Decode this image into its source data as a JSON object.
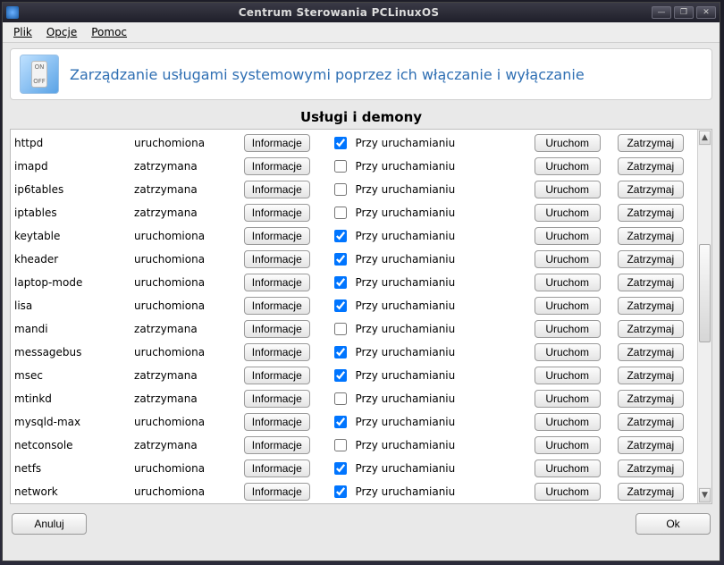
{
  "window": {
    "title": "Centrum Sterowania PCLinuxOS"
  },
  "menu": {
    "plik": "Plik",
    "opcje": "Opcje",
    "pomoc": "Pomoc"
  },
  "banner": {
    "text": "Zarządzanie usługami systemowymi poprzez ich włączanie i wyłączanie"
  },
  "section_title": "Usługi i demony",
  "labels": {
    "info": "Informacje",
    "on_boot": "Przy uruchamianiu",
    "start": "Uruchom",
    "stop": "Zatrzymaj"
  },
  "status": {
    "running": "uruchomiona",
    "stopped": "zatrzymana"
  },
  "footer": {
    "cancel": "Anuluj",
    "ok": "Ok"
  },
  "services": [
    {
      "name": "httpd",
      "status": "running",
      "on_boot": true
    },
    {
      "name": "imapd",
      "status": "stopped",
      "on_boot": false
    },
    {
      "name": "ip6tables",
      "status": "stopped",
      "on_boot": false
    },
    {
      "name": "iptables",
      "status": "stopped",
      "on_boot": false
    },
    {
      "name": "keytable",
      "status": "running",
      "on_boot": true
    },
    {
      "name": "kheader",
      "status": "running",
      "on_boot": true
    },
    {
      "name": "laptop-mode",
      "status": "running",
      "on_boot": true
    },
    {
      "name": "lisa",
      "status": "running",
      "on_boot": true
    },
    {
      "name": "mandi",
      "status": "stopped",
      "on_boot": false
    },
    {
      "name": "messagebus",
      "status": "running",
      "on_boot": true
    },
    {
      "name": "msec",
      "status": "stopped",
      "on_boot": true
    },
    {
      "name": "mtinkd",
      "status": "stopped",
      "on_boot": false
    },
    {
      "name": "mysqld-max",
      "status": "running",
      "on_boot": true
    },
    {
      "name": "netconsole",
      "status": "stopped",
      "on_boot": false
    },
    {
      "name": "netfs",
      "status": "running",
      "on_boot": true
    },
    {
      "name": "network",
      "status": "running",
      "on_boot": true
    }
  ]
}
